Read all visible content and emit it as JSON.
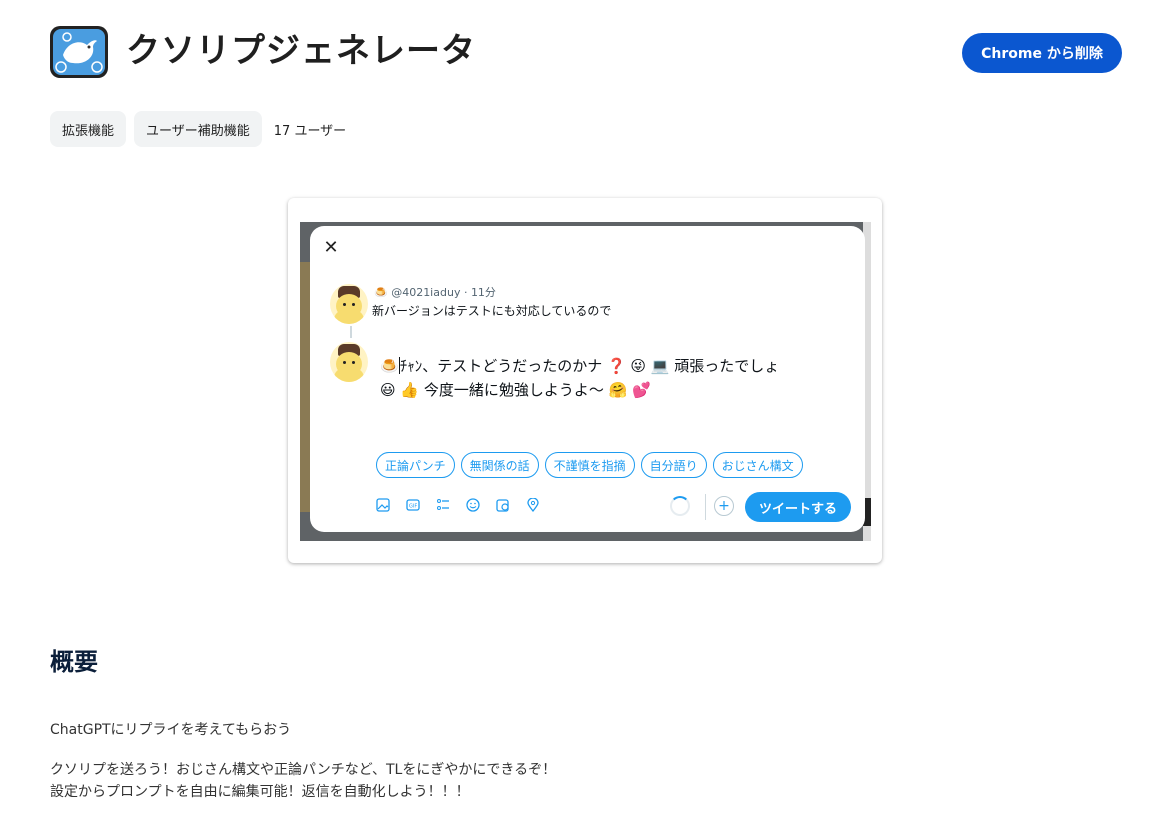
{
  "header": {
    "title": "クソリプジェネレータ",
    "remove_button": "Chrome から削除",
    "icon": "bird-logo-icon"
  },
  "chips": [
    "拡張機能",
    "ユーザー補助機能"
  ],
  "user_count": "17 ユーザー",
  "screenshot": {
    "meta": "🍮 @4021iaduy · 11分",
    "original_text": "新バージョンはテストにも対応しているので",
    "compose_line1": "🍮",
    "compose_line1b": "ﾁｬﾝ、テストどうだったのかナ ❓ 😜 💻 頑張ったでしょ",
    "compose_line2": "😃 👍 今度一緒に勉強しようよ〜 🤗 💕",
    "pills": [
      "正論パンチ",
      "無関係の話",
      "不謹慎を指摘",
      "自分語り",
      "おじさん構文"
    ],
    "tweet_button": "ツイートする",
    "close": "✕",
    "plus": "+",
    "toolbar_icons": [
      "image-icon",
      "gif-icon",
      "poll-icon",
      "emoji-icon",
      "schedule-icon",
      "location-icon"
    ]
  },
  "overview": {
    "title": "概要",
    "summary": "ChatGPTにリプライを考えてもらおう",
    "desc_line1": "クソリプを送ろう！おじさん構文や正論パンチなど、TLをにぎやかにできるぞ！",
    "desc_line2": "設定からプロンプトを自由に編集可能！返信を自動化しよう！！！"
  },
  "colors": {
    "primary": "#0b57d0",
    "twitter_blue": "#1d9bf0"
  }
}
